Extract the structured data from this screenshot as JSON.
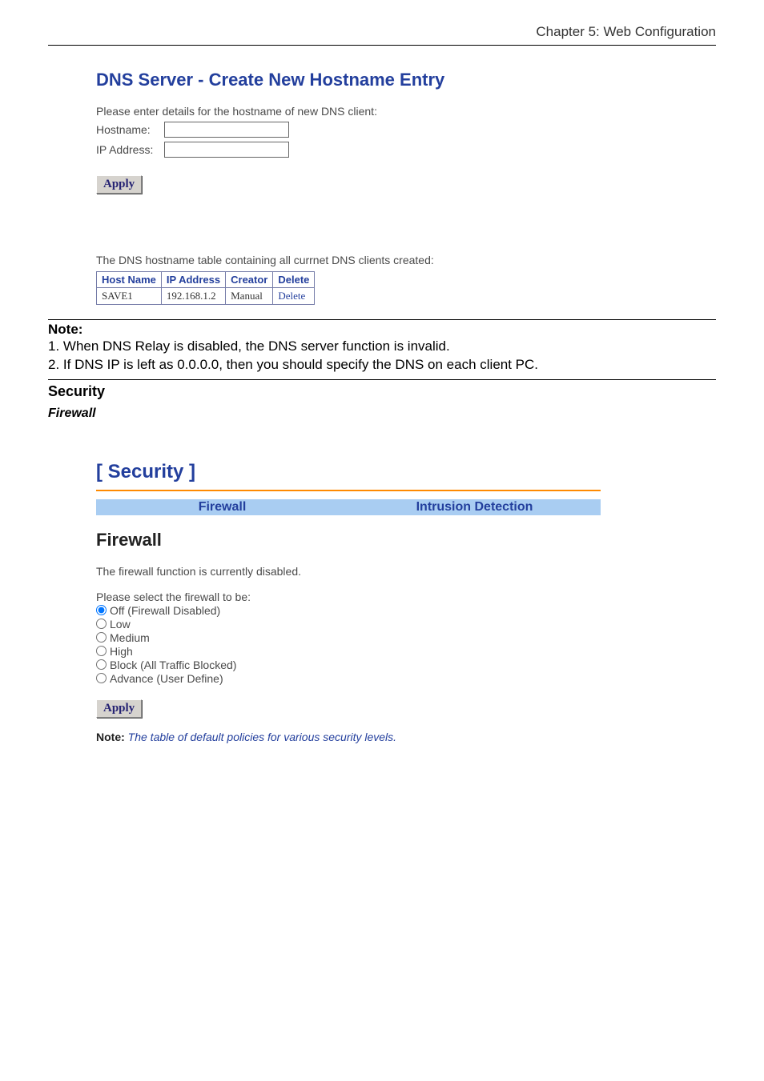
{
  "chapter_header": "Chapter 5: Web Configuration",
  "dns_panel": {
    "title": "DNS Server - Create New Hostname Entry",
    "intro": "Please enter details for the hostname of new DNS client:",
    "hostname_label": "Hostname:",
    "ip_label": "IP Address:",
    "apply_label": "Apply",
    "table_intro": "The DNS hostname table containing all currnet DNS clients created:",
    "table_headers": {
      "hostname": "Host Name",
      "ip": "IP Address",
      "creator": "Creator",
      "delete": "Delete"
    },
    "table_row": {
      "hostname": "SAVE1",
      "ip": "192.168.1.2",
      "creator": "Manual",
      "delete": "Delete"
    }
  },
  "doc_note": {
    "heading": "Note:",
    "line1": "1. When DNS Relay is disabled, the DNS server function is invalid.",
    "line2": "2. If DNS IP is left as 0.0.0.0, then you should specify the DNS on each client PC."
  },
  "doc_section": {
    "security_heading": "Security",
    "firewall_subheading": "Firewall"
  },
  "security_panel": {
    "title": "[ Security ]",
    "tabs": {
      "firewall": "Firewall",
      "intrusion": "Intrusion Detection"
    },
    "firewall_heading": "Firewall",
    "status_text": "The firewall function is currently disabled.",
    "select_label": "Please select the firewall to be:",
    "options": {
      "off": "Off (Firewall Disabled)",
      "low": "Low",
      "medium": "Medium",
      "high": "High",
      "block": "Block (All Traffic Blocked)",
      "advance": "Advance (User Define)"
    },
    "apply_label": "Apply",
    "note_strong": "Note:",
    "note_text": " The table of default policies for various security levels."
  }
}
